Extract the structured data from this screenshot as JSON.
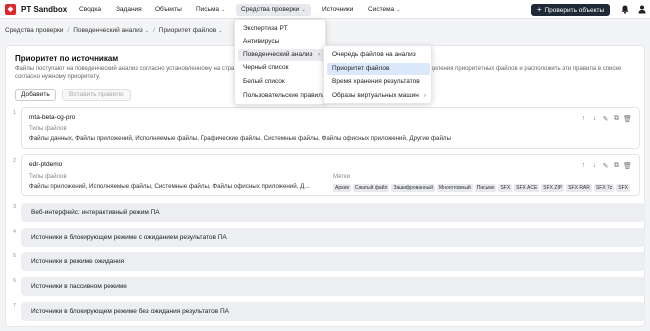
{
  "app": {
    "title": "PT Sandbox",
    "logo_letter": "◆"
  },
  "nav": [
    {
      "label": "Сводка"
    },
    {
      "label": "Задания"
    },
    {
      "label": "Объекты"
    },
    {
      "label": "Письма"
    },
    {
      "label": "Средства проверки"
    },
    {
      "label": "Источники"
    },
    {
      "label": "Система"
    }
  ],
  "check_objects_label": "Проверить объекты",
  "breadcrumbs": [
    "Средства проверки",
    "Поведенческий анализ",
    "Приоритет файлов"
  ],
  "page": {
    "title": "Приоритет по источникам",
    "description": "Файлы поступают на поведенческий анализ согласно установленному на странице «Очередь файлов на анализ». Вы можете создать правила определения приоритетных файлов и расположить эти правила в списке согласно нужному приоритету.",
    "add_button": "Добавить",
    "insert_button": "Вставить правило"
  },
  "rules": [
    {
      "num": "1",
      "name": "mta-beta-cg-pro",
      "types_label": "Типы файлов",
      "types_value": "Файлы данных, Файлы приложений, Исполняемые файлы, Графические файлы, Системные файлы, Файлы офисных приложений, Другие файлы"
    },
    {
      "num": "2",
      "name": "edr-ptdemo",
      "types_label": "Типы файлов",
      "types_value": "Файлы приложений, Исполняемые файлы, Системные файлы, Файлы офисных приложений, Д...",
      "tags_label": "Метки",
      "tags": [
        "Архив",
        "Сжатый файл",
        "Зашифрованный",
        "Многотомный",
        "Письмо",
        "SFX",
        "SFX ACE",
        "SFX ZIP",
        "SFX RAR",
        "SFX 7z",
        "SFX"
      ]
    }
  ],
  "modes": [
    {
      "num": "3",
      "label": "Веб-интерфейс: интерактивный режим ПА"
    },
    {
      "num": "4",
      "label": "Источники в блокирующем режиме с ожиданием результатов ПА"
    },
    {
      "num": "5",
      "label": "Источники в режиме ожидания"
    },
    {
      "num": "6",
      "label": "Источники в пассивном режиме"
    },
    {
      "num": "7",
      "label": "Источники в блокирующем режиме без ожидания результатов ПА"
    }
  ],
  "menu_tools": [
    "Экспертиза PT",
    "Антивирусы",
    "Поведенческий анализ",
    "Черный список",
    "Белый список",
    "Пользовательские правила"
  ],
  "menu_behavior": [
    "Очередь файлов на анализ",
    "Приоритет файлов",
    "Время хранения результатов",
    "Образы виртуальных машин"
  ],
  "colors": {
    "brand": "#e0262b",
    "primary_button": "#1f2937",
    "selected_menu": "#dbe7fb"
  }
}
